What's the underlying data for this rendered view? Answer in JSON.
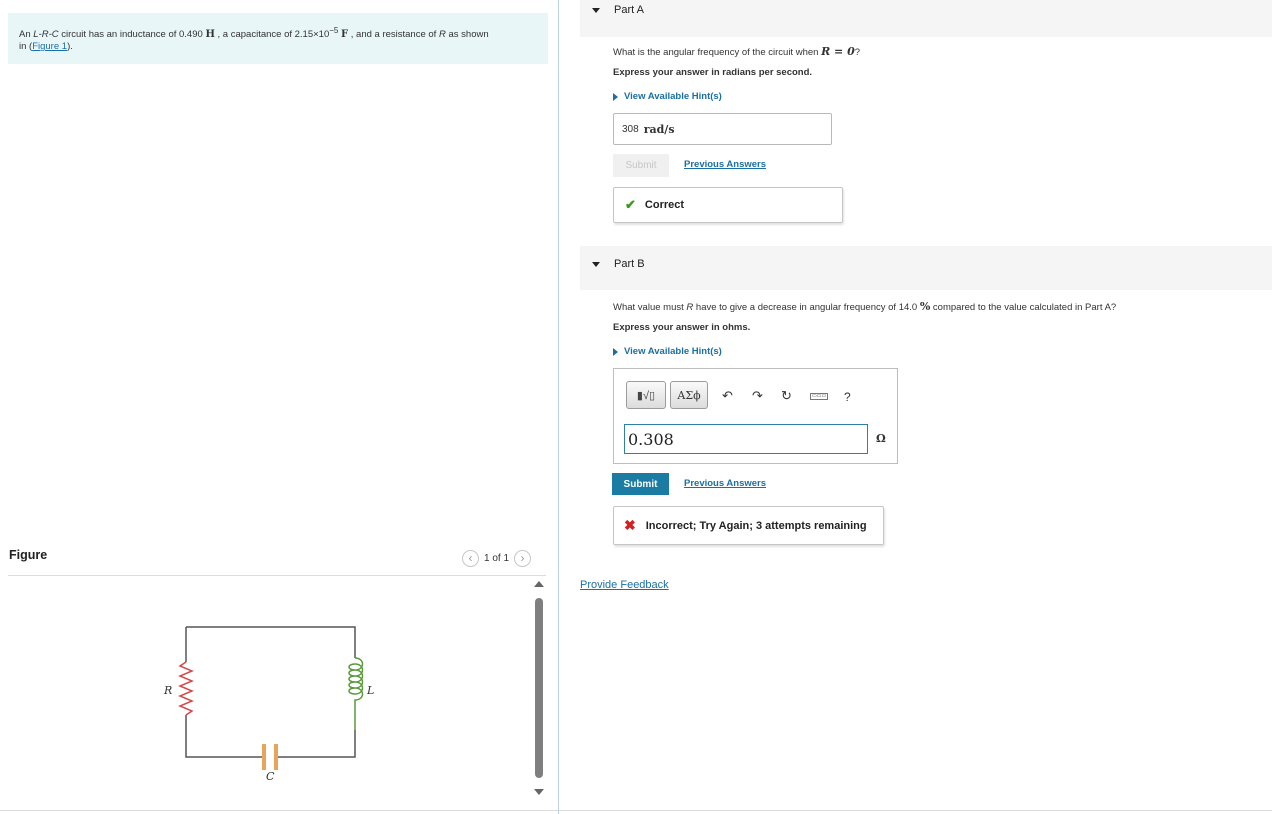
{
  "problem": {
    "text_1": "An ",
    "circuit_type": "L-R-C",
    "text_2": " circuit has an inductance of 0.490 ",
    "unit_H": "H",
    "text_3": " , a capacitance of 2.15×10",
    "cap_exp": "−5",
    "unit_F": "F",
    "text_4": " , and a resistance of ",
    "var_R": "R",
    "text_5": " as shown",
    "text_6": "in (",
    "figure_link": "Figure 1",
    "text_7": ")."
  },
  "figure": {
    "title": "Figure",
    "pager": "1 of 1",
    "labels": {
      "R": "R",
      "L": "L",
      "C": "C"
    }
  },
  "part_a": {
    "label": "Part A",
    "question_1": "What is the angular frequency of the circuit when ",
    "question_math": "R = 0",
    "question_2": "?",
    "instruction": "Express your answer in radians per second.",
    "hint_label": "View Available Hint(s)",
    "answer_value": "308",
    "answer_unit": "rad/s",
    "submit_label": "Submit",
    "prev_answers_label": "Previous Answers",
    "feedback": "Correct"
  },
  "part_b": {
    "label": "Part B",
    "question_1": "What value must ",
    "question_var": "R",
    "question_2": " have to give a decrease in angular frequency of 14.0 ",
    "question_pct": "%",
    "question_3": " compared to the value calculated in Part A?",
    "instruction": "Express your answer in ohms.",
    "hint_label": "View Available Hint(s)",
    "toolbar": {
      "templates_label": "▮√▯",
      "greek_label": "ΑΣϕ",
      "undo_icon": "↶",
      "redo_icon": "↷",
      "reset_icon": "↻",
      "keyboard_label": "▭▭▭",
      "help_label": "?"
    },
    "answer_value": "0.308",
    "answer_unit": "Ω",
    "submit_label": "Submit",
    "prev_answers_label": "Previous Answers",
    "feedback": "Incorrect; Try Again; 3 attempts remaining"
  },
  "footer": {
    "provide_feedback": "Provide Feedback"
  },
  "colors": {
    "problem_bg": "#e8f6f7",
    "link": "#1b6fa3",
    "submit_bg": "#1a7ba3",
    "correct": "#3b9b1f",
    "incorrect": "#d02020"
  }
}
